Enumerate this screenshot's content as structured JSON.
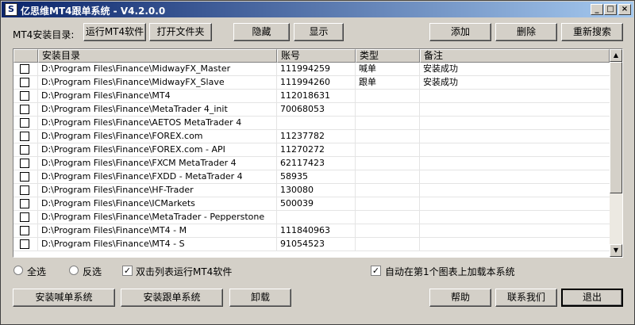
{
  "window": {
    "title": "亿思维MT4跟单系统 - V4.2.0.0",
    "minimize": "_",
    "maximize": "□",
    "close": "×"
  },
  "toolbar": {
    "dir_label": "MT4安装目录:",
    "run_mt4": "运行MT4软件",
    "open_folder": "打开文件夹",
    "hide": "隐藏",
    "show": "显示",
    "add": "添加",
    "delete": "删除",
    "research": "重新搜索"
  },
  "table": {
    "columns": [
      "",
      "安装目录",
      "账号",
      "类型",
      "备注"
    ],
    "rows": [
      {
        "path": "D:\\Program Files\\Finance\\MidwayFX_Master",
        "account": "111994259",
        "type": "喊单",
        "note": "安装成功"
      },
      {
        "path": "D:\\Program Files\\Finance\\MidwayFX_Slave",
        "account": "111994260",
        "type": "跟单",
        "note": "安装成功"
      },
      {
        "path": "D:\\Program Files\\Finance\\MT4",
        "account": "112018631",
        "type": "",
        "note": ""
      },
      {
        "path": "D:\\Program Files\\Finance\\MetaTrader 4_init",
        "account": "70068053",
        "type": "",
        "note": ""
      },
      {
        "path": "D:\\Program Files\\Finance\\AETOS MetaTrader 4",
        "account": "",
        "type": "",
        "note": ""
      },
      {
        "path": "D:\\Program Files\\Finance\\FOREX.com",
        "account": "11237782",
        "type": "",
        "note": ""
      },
      {
        "path": "D:\\Program Files\\Finance\\FOREX.com - API",
        "account": "11270272",
        "type": "",
        "note": ""
      },
      {
        "path": "D:\\Program Files\\Finance\\FXCM MetaTrader 4",
        "account": "62117423",
        "type": "",
        "note": ""
      },
      {
        "path": "D:\\Program Files\\Finance\\FXDD - MetaTrader 4",
        "account": "58935",
        "type": "",
        "note": ""
      },
      {
        "path": "D:\\Program Files\\Finance\\HF-Trader",
        "account": "130080",
        "type": "",
        "note": ""
      },
      {
        "path": "D:\\Program Files\\Finance\\ICMarkets",
        "account": "500039",
        "type": "",
        "note": ""
      },
      {
        "path": "D:\\Program Files\\Finance\\MetaTrader - Pepperstone",
        "account": "",
        "type": "",
        "note": ""
      },
      {
        "path": "D:\\Program Files\\Finance\\MT4 - M",
        "account": "111840963",
        "type": "",
        "note": ""
      },
      {
        "path": "D:\\Program Files\\Finance\\MT4 - S",
        "account": "91054523",
        "type": "",
        "note": ""
      }
    ]
  },
  "options": {
    "select_all": "全选",
    "invert": "反选",
    "dblclick_run": "双击列表运行MT4软件",
    "auto_load": "自动在第1个图表上加载本系统",
    "check_mark": "✓"
  },
  "bottom": {
    "install_signal": "安装喊单系统",
    "install_follow": "安装跟单系统",
    "uninstall": "卸载",
    "help": "帮助",
    "contact": "联系我们",
    "exit": "退出"
  },
  "scroll": {
    "up": "▲",
    "down": "▼"
  },
  "colors": {
    "titlebar_start": "#0a246a",
    "titlebar_end": "#a6caf0",
    "face": "#d4d0c8"
  }
}
